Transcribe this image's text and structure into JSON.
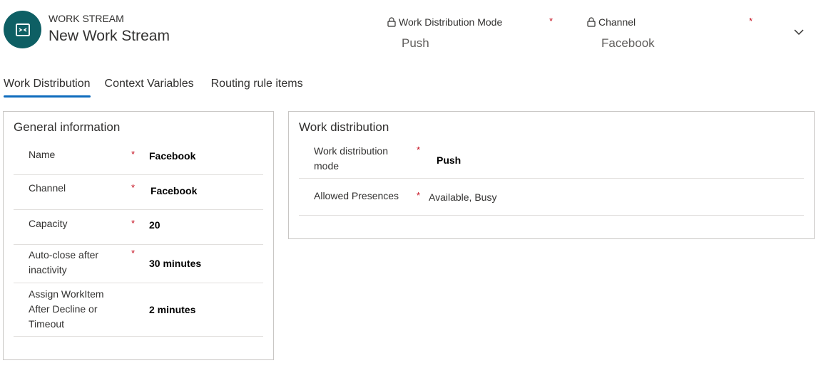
{
  "header": {
    "entity_type": "WORK STREAM",
    "title": "New Work Stream",
    "icon": "work-stream-icon",
    "fields": [
      {
        "label": "Work Distribution Mode",
        "value": "Push",
        "required": "*",
        "locked": "lock-icon"
      },
      {
        "label": "Channel",
        "value": "Facebook",
        "required": "*",
        "locked": "lock-icon"
      }
    ],
    "expand_icon": "chevron-down-icon"
  },
  "tabs": [
    {
      "label": "Work Distribution",
      "active": true
    },
    {
      "label": "Context Variables",
      "active": false
    },
    {
      "label": "Routing rule items",
      "active": false
    }
  ],
  "general": {
    "title": "General information",
    "fields": [
      {
        "label": "Name",
        "required": "*",
        "value": "Facebook"
      },
      {
        "label": "Channel",
        "required": "*",
        "value": "Facebook"
      },
      {
        "label": "Capacity",
        "required": "*",
        "value": "20"
      },
      {
        "label": "Auto-close after inactivity",
        "required": "*",
        "value": "30 minutes"
      },
      {
        "label": "Assign WorkItem After Decline or Timeout",
        "required": "",
        "value": "2 minutes"
      }
    ]
  },
  "distribution": {
    "title": "Work distribution",
    "fields": [
      {
        "label": "Work distribution mode",
        "required": "*",
        "value": "Push"
      },
      {
        "label": "Allowed Presences",
        "required": "*",
        "value": "Available, Busy"
      }
    ]
  },
  "colors": {
    "accent": "#0f6cbd",
    "avatar": "#0e5f64",
    "required": "#c50f1f"
  }
}
